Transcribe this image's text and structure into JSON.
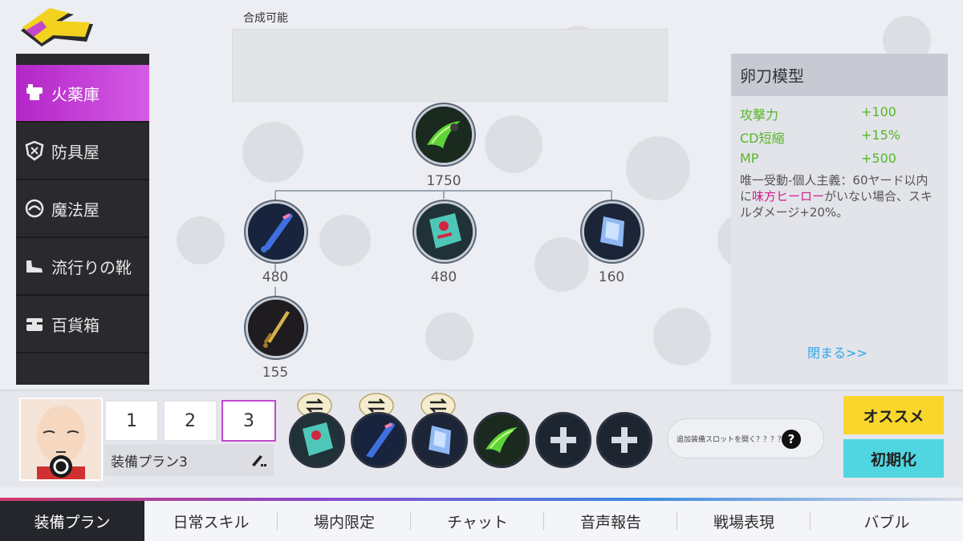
{
  "combinable_label": "合成可能",
  "sidebar": {
    "items": [
      {
        "label": "火薬庫",
        "icon": "weapon-shop-icon",
        "active": true
      },
      {
        "label": "防具屋",
        "icon": "armor-shop-icon",
        "active": false
      },
      {
        "label": "魔法屋",
        "icon": "magic-shop-icon",
        "active": false
      },
      {
        "label": "流行りの靴",
        "icon": "shoes-icon",
        "active": false
      },
      {
        "label": "百貨箱",
        "icon": "treasure-box-icon",
        "active": false
      }
    ]
  },
  "recipe_tree": {
    "root": {
      "price": "1750",
      "icon": "green-blade-icon"
    },
    "children": [
      {
        "price": "480",
        "icon": "blue-bat-icon"
      },
      {
        "price": "480",
        "icon": "death-book-icon"
      },
      {
        "price": "160",
        "icon": "blue-crystal-icon"
      }
    ],
    "grandchild": {
      "price": "155",
      "icon": "golden-sword-icon"
    }
  },
  "detail": {
    "title": "卵刀模型",
    "stats": [
      {
        "name": "攻撃力",
        "value": "+100"
      },
      {
        "name": "CD短縮",
        "value": "+15%"
      },
      {
        "name": "MP",
        "value": "+500"
      }
    ],
    "passive_before": "唯一受動-個人主義：60ヤード以内に",
    "passive_highlight": "味方ヒーロー",
    "passive_after": "がいない場合、スキルダメージ+20%。",
    "close_label": "閉まる>>"
  },
  "equip": {
    "plans": [
      "1",
      "2",
      "3"
    ],
    "active_plan": "3",
    "plan_name": "装備プラン3",
    "slots": [
      "death-book-icon",
      "blue-bat-icon",
      "blue-crystal-icon",
      "green-blade-icon",
      "plus-icon",
      "plus-icon"
    ],
    "extra_slot_text": "追加装備スロットを開く？？？？",
    "help_symbol": "?",
    "recommend_label": "オススメ",
    "reset_label": "初期化"
  },
  "tabs": [
    {
      "label": "装備プラン",
      "active": true
    },
    {
      "label": "日常スキル",
      "active": false
    },
    {
      "label": "場内限定",
      "active": false
    },
    {
      "label": "チャット",
      "active": false
    },
    {
      "label": "音声報告",
      "active": false
    },
    {
      "label": "戦場表現",
      "active": false
    },
    {
      "label": "バブル",
      "active": false
    }
  ],
  "colors": {
    "sidebar_active": "#b325c8",
    "stat_green": "#58b52a",
    "highlight_pink": "#d21b8a",
    "close_link": "#2ea6e6",
    "recommend_yellow": "#f8d62c",
    "reset_cyan": "#4fd6e0"
  }
}
